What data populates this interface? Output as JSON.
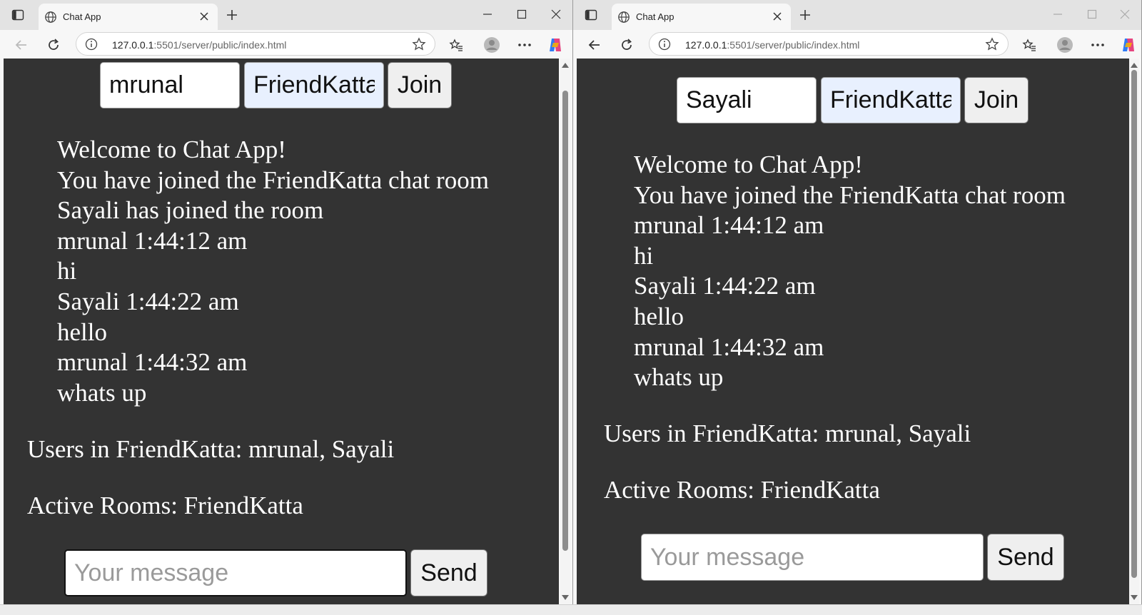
{
  "left_window": {
    "tab_title": "Chat App",
    "url": {
      "host": "127.0.0.1",
      "rest": ":5501/server/public/index.html"
    },
    "form": {
      "username_value": "mrunal",
      "room_value": "FriendKatta",
      "join_label": "Join"
    },
    "messages": [
      "Welcome to Chat App!",
      "You have joined the FriendKatta chat room",
      "Sayali has joined the room",
      "mrunal 1:44:12 am",
      "hi",
      "Sayali 1:44:22 am",
      "hello",
      "mrunal 1:44:32 am",
      "whats up"
    ],
    "users_line": "Users in FriendKatta: mrunal, Sayali",
    "rooms_line": "Active Rooms: FriendKatta",
    "message_placeholder": "Your message",
    "send_label": "Send"
  },
  "right_window": {
    "tab_title": "Chat App",
    "url": {
      "host": "127.0.0.1",
      "rest": ":5501/server/public/index.html"
    },
    "form": {
      "username_value": "Sayali",
      "room_value": "FriendKatta",
      "join_label": "Join"
    },
    "messages": [
      "Welcome to Chat App!",
      "You have joined the FriendKatta chat room",
      "mrunal 1:44:12 am",
      "hi",
      "Sayali 1:44:22 am",
      "hello",
      "mrunal 1:44:32 am",
      "whats up"
    ],
    "users_line": "Users in FriendKatta: mrunal, Sayali",
    "rooms_line": "Active Rooms: FriendKatta",
    "message_placeholder": "Your message",
    "send_label": "Send"
  },
  "colors": {
    "page_background": "#333333",
    "text": "#ffffff",
    "room_input_background": "#e8f0fe",
    "browser_chrome": "#f7f7f7",
    "tab_strip": "#e3e3e3"
  },
  "icons": [
    "sidebar-toggle-icon",
    "globe-icon",
    "close-icon",
    "plus-icon",
    "minimize-icon",
    "maximize-icon",
    "back-arrow-icon",
    "refresh-icon",
    "info-icon",
    "star-icon",
    "favorites-icon",
    "profile-icon",
    "more-icon",
    "copilot-icon"
  ]
}
